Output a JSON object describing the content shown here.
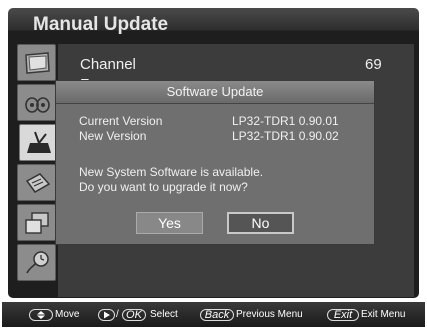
{
  "window": {
    "title": "Manual Update"
  },
  "main": {
    "channel_label": "Channel",
    "channel_value": "69",
    "partial_label": "F"
  },
  "dialog": {
    "title": "Software Update",
    "current_label": "Current Version",
    "current_value": "LP32-TDR1 0.90.01",
    "new_label": "New Version",
    "new_value": "LP32-TDR1 0.90.02",
    "message_line1": "New System Software is available.",
    "message_line2": "Do you want to upgrade it now?",
    "yes_label": "Yes",
    "no_label": "No"
  },
  "footer": {
    "move_label": "Move",
    "select_slash": "/",
    "ok_key": "OK",
    "select_label": "Select",
    "back_key": "Back",
    "back_label": "Previous Menu",
    "exit_key": "Exit",
    "exit_label": "Exit Menu"
  },
  "sidebar": {
    "icons": [
      "picture-icon",
      "audio-icon",
      "setup-icon",
      "input-icon",
      "multi-screen-icon",
      "time-icon"
    ]
  }
}
